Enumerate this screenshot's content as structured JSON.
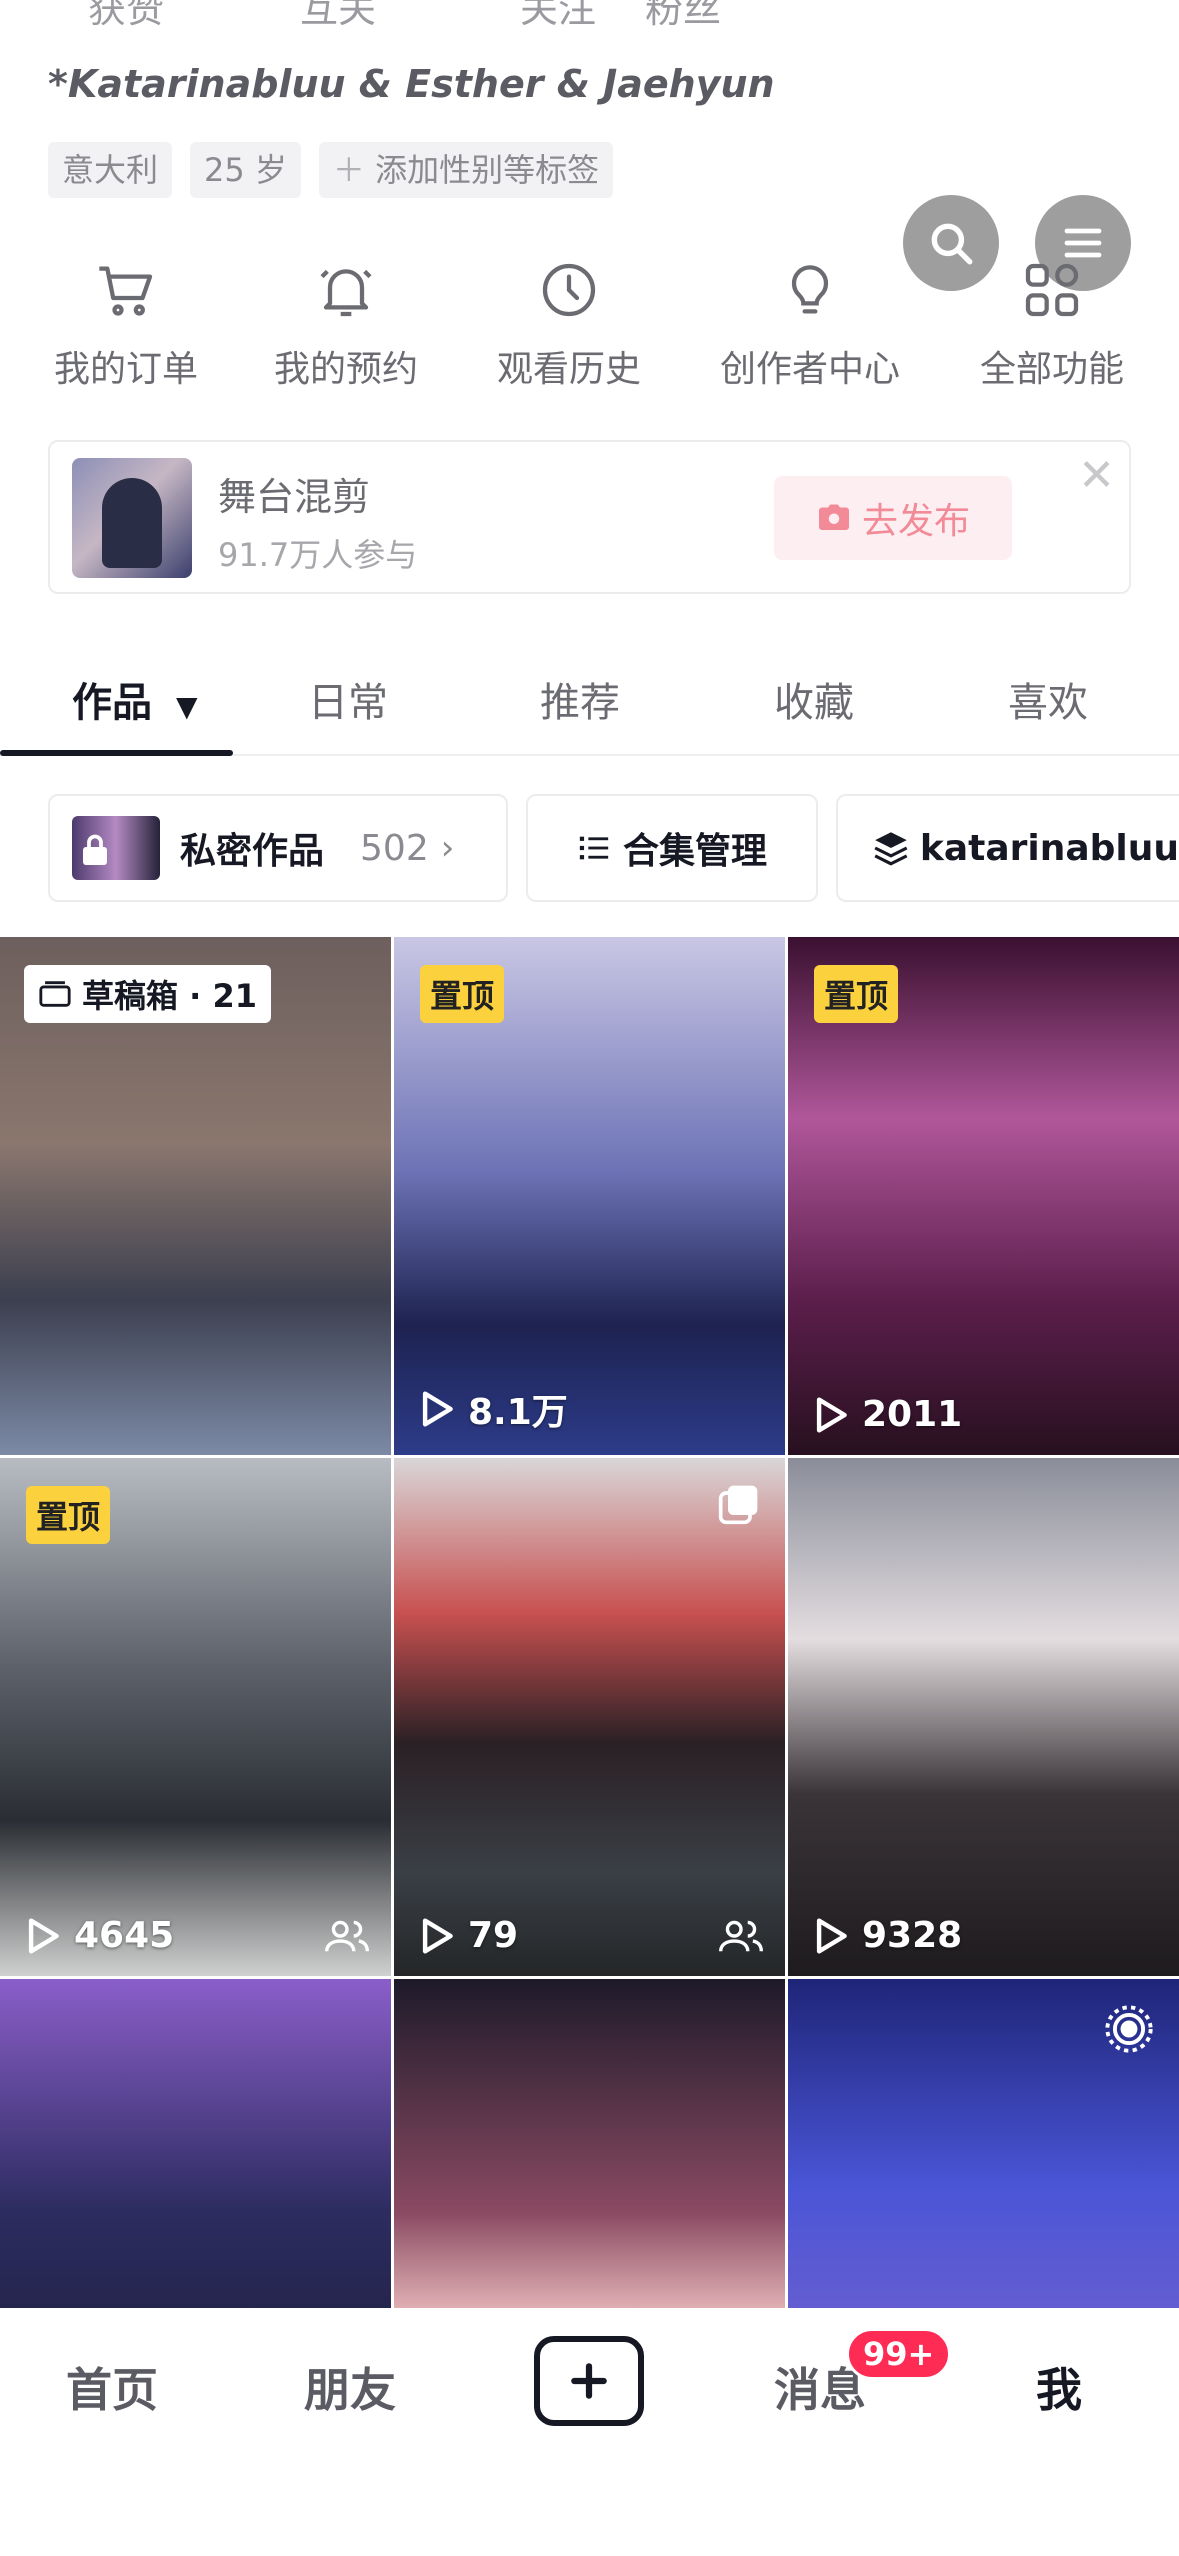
{
  "profile": {
    "stats_labels": [
      "获赞",
      "互关",
      "关注",
      "粉丝"
    ],
    "bio_name": "*Katarinabluu & Esther & Jaehyun",
    "tags": [
      "意大利",
      "25 岁",
      "添加性别等标签"
    ]
  },
  "floating": {
    "search_icon": "search-icon",
    "menu_icon": "menu-icon"
  },
  "functions": [
    {
      "label": "我的订单",
      "icon": "cart-icon"
    },
    {
      "label": "我的预约",
      "icon": "bell-icon"
    },
    {
      "label": "观看历史",
      "icon": "clock-icon"
    },
    {
      "label": "创作者中心",
      "icon": "lightbulb-icon"
    },
    {
      "label": "全部功能",
      "icon": "grid-icon"
    }
  ],
  "promo": {
    "title": "舞台混剪",
    "subtitle": "91.7万人参与",
    "button": "去发布"
  },
  "tabs": [
    {
      "label": "作品",
      "active": true
    },
    {
      "label": "日常"
    },
    {
      "label": "推荐"
    },
    {
      "label": "收藏"
    },
    {
      "label": "喜欢"
    }
  ],
  "toolbar": {
    "private_label": "私密作品",
    "private_count": "502",
    "collection_label": "合集管理",
    "account_label": "katarinabluu"
  },
  "videos": [
    {
      "badge": "草稿箱 · 21",
      "badge_type": "draft",
      "views": "",
      "bg": "#6f5b57"
    },
    {
      "badge": "置顶",
      "badge_type": "pinned",
      "views": "8.1万",
      "bg": "#2f3a78"
    },
    {
      "badge": "置顶",
      "badge_type": "pinned",
      "views": "2011",
      "bg": "#5a1e4e"
    },
    {
      "badge": "置顶",
      "badge_type": "pinned",
      "views": "4645",
      "bg": "#4a4f58",
      "friends": true
    },
    {
      "badge": "",
      "badge_type": "",
      "views": "79",
      "bg": "#3a2c30",
      "friends": true,
      "multi": true
    },
    {
      "badge": "",
      "badge_type": "",
      "views": "9328",
      "bg": "#6c6f7a"
    },
    {
      "badge": "",
      "badge_type": "",
      "views": "",
      "bg": "#3a3e78"
    },
    {
      "badge": "",
      "badge_type": "",
      "views": "",
      "bg": "#3b1e36"
    },
    {
      "badge": "",
      "badge_type": "",
      "views": "",
      "bg": "#3a42b0",
      "live": true
    }
  ],
  "bottom_nav": {
    "home": "首页",
    "friends": "朋友",
    "messages": "消息",
    "messages_badge": "99+",
    "me": "我"
  },
  "colors": {
    "accent": "#fe2c55",
    "pin": "#fbd13d",
    "text": "#161823"
  }
}
